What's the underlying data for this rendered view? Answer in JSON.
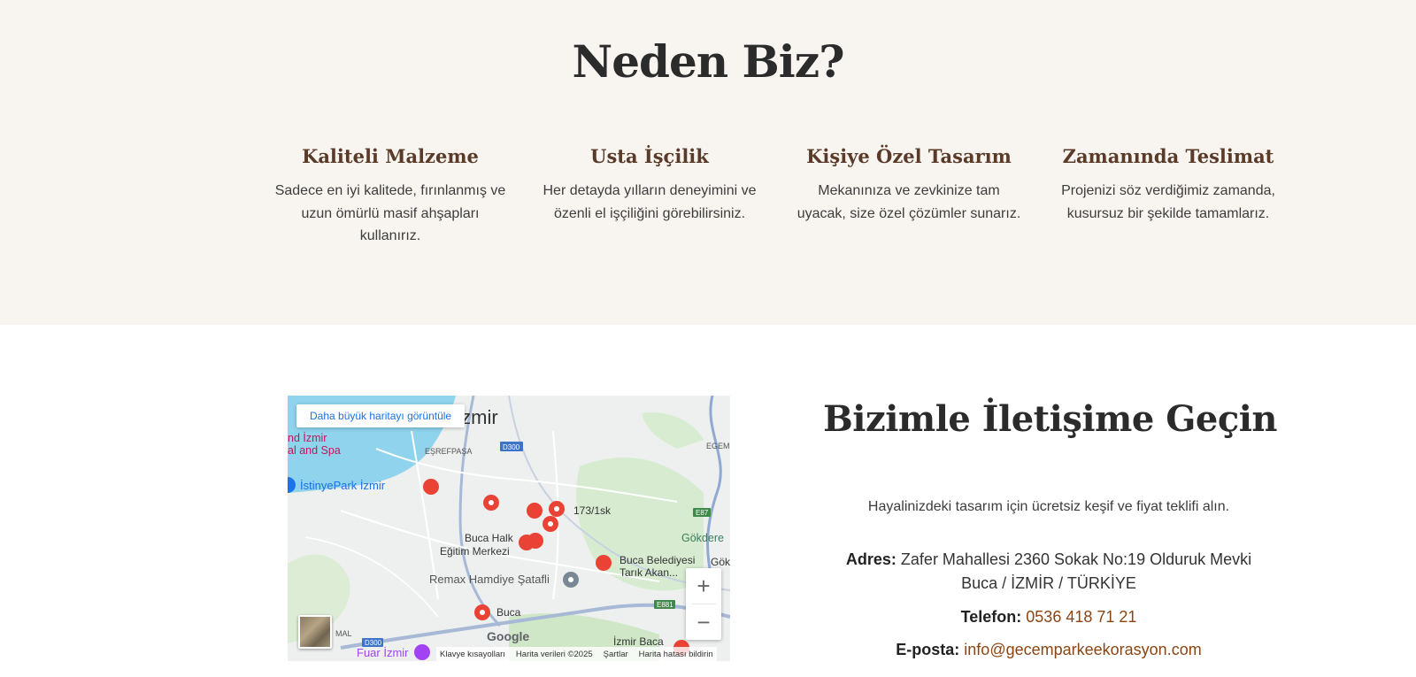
{
  "why": {
    "title": "Neden Biz?",
    "features": [
      {
        "title": "Kaliteli Malzeme",
        "text": "Sadece en iyi kalitede, fırınlanmış ve uzun ömürlü masif ahşapları kullanırız."
      },
      {
        "title": "Usta İşçilik",
        "text": "Her detayda yılların deneyimini ve özenli el işçiliğini görebilirsiniz."
      },
      {
        "title": "Kişiye Özel Tasarım",
        "text": "Mekanınıza ve zevkinize tam uyacak, size özel çözümler sunarız."
      },
      {
        "title": "Zamanında Teslimat",
        "text": "Projenizi söz verdiğimiz zamanda, kusursuz bir şekilde tamamlarız."
      }
    ]
  },
  "map": {
    "view_larger": "Daha büyük haritayı görüntüle",
    "labels": {
      "izmir": "İzmir",
      "spa1": "nd İzmir",
      "spa2": "al and Spa",
      "esrefpasa": "EŞREFPAŞA",
      "d300": "D300",
      "istinye": "İstinyePark İzmir",
      "egem": "EGEM",
      "street": "173/1sk",
      "e87": "E87",
      "gokdere": "Gökdere",
      "bucahalk1": "Buca Halk",
      "bucahalk2": "Eğitim Merkezi",
      "belediye1": "Buca Belediyesi",
      "belediye2": "Tarık Akan...",
      "gok": "Gök",
      "remax": "Remax Hamdiye Şatafli",
      "e881": "E881",
      "buca": "Buca",
      "d300b": "D300",
      "mal": "MAL",
      "fuar": "Fuar İzmir",
      "izmirbaca": "İzmir Baca"
    },
    "google": "Google",
    "attribution": [
      "Klavye kısayolları",
      "Harita verileri ©2025",
      "Şartlar",
      "Harita hatası bildirin"
    ],
    "zoom_in": "+",
    "zoom_out": "−"
  },
  "contact": {
    "title": "Bizimle İletişime Geçin",
    "subtitle": "Hayalinizdeki tasarım için ücretsiz keşif ve fiyat teklifi alın.",
    "address_label": "Adres:",
    "address_line1": "Zafer Mahallesi 2360 Sokak No:19 Olduruk Mevki",
    "address_line2": "Buca / İZMİR / TÜRKİYE",
    "phone_label": "Telefon:",
    "phone": "0536 418 71 21",
    "email_label": "E-posta:",
    "email": "info@gecemparkeekorasyon.com",
    "accent_color": "#8b4513"
  }
}
